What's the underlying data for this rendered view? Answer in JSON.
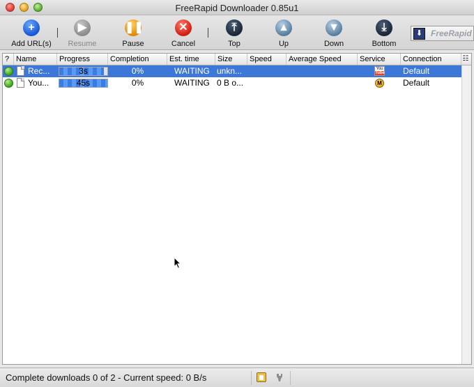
{
  "window": {
    "title": "FreeRapid Downloader 0.85u1"
  },
  "toolbar": {
    "add_label": "Add URL(s)",
    "resume_label": "Resume",
    "pause_label": "Pause",
    "cancel_label": "Cancel",
    "top_label": "Top",
    "up_label": "Up",
    "down_label": "Down",
    "bottom_label": "Bottom",
    "brand_text": "FreeRapid"
  },
  "table": {
    "columns": [
      "?",
      "Name",
      "Progress",
      "Completion",
      "Est. time",
      "Size",
      "Speed",
      "Average Speed",
      "Service",
      "Connection"
    ],
    "rows": [
      {
        "name": "Rec...",
        "progress_text": "3s",
        "progress_fill": 0.93,
        "completion": "0%",
        "est_time": "WAITING",
        "size": "unkn...",
        "speed": "",
        "average_speed": "",
        "service_icon": "youtube-icon",
        "connection": "Default",
        "selected": true
      },
      {
        "name": "You...",
        "progress_text": "45s",
        "progress_fill": 1.0,
        "completion": "0%",
        "est_time": "WAITING",
        "size": "0 B o...",
        "speed": "",
        "average_speed": "",
        "service_icon": "megaupload-icon",
        "connection": "Default",
        "selected": false
      }
    ]
  },
  "statusbar": {
    "text": "Complete downloads 0 of 2 - Current speed: 0 B/s"
  },
  "colors": {
    "selection": "#3d78d8",
    "progress": "#3a7ce6",
    "status_ok": "#3aa21a"
  }
}
